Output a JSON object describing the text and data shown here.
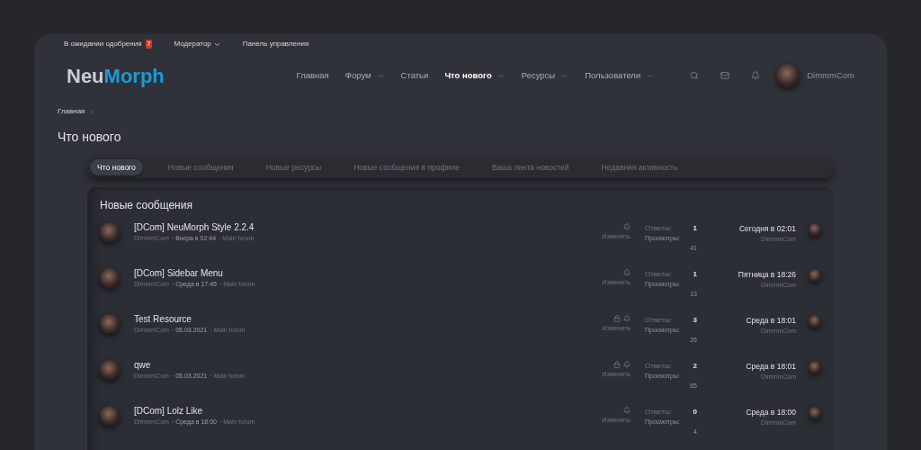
{
  "top_bar": [
    {
      "label": "В ожидании одобрения",
      "badge": "7",
      "dropdown": false
    },
    {
      "label": "Модератор",
      "dropdown": true
    },
    {
      "label": "Панель управления",
      "dropdown": false
    }
  ],
  "logo": {
    "part_1": "Neu",
    "part_2": "Morph"
  },
  "nav": [
    {
      "label": "Главная",
      "selected": false,
      "dropdown": false
    },
    {
      "label": "Форум",
      "selected": false,
      "dropdown": true
    },
    {
      "label": "Статьи",
      "selected": false,
      "dropdown": false
    },
    {
      "label": "Что нового",
      "selected": true,
      "dropdown": true
    },
    {
      "label": "Ресурсы",
      "selected": false,
      "dropdown": true
    },
    {
      "label": "Пользователи",
      "selected": false,
      "dropdown": true
    }
  ],
  "user": {
    "name": "DimmmCom"
  },
  "breadcrumb": [
    "Главная"
  ],
  "page_title": "Что нового",
  "tabs": [
    {
      "label": "Что нового",
      "selected": true
    },
    {
      "label": "Новые сообщения",
      "selected": false
    },
    {
      "label": "Новые ресурсы",
      "selected": false
    },
    {
      "label": "Новые сообщения в профиле",
      "selected": false
    },
    {
      "label": "Ваша лента новостей",
      "selected": false
    },
    {
      "label": "Недавняя активность",
      "selected": false
    }
  ],
  "block_title": "Новые сообщения",
  "threads": [
    {
      "title": "[DCom] NeuMorph Style 2.2.4",
      "author": "DimmmCom",
      "date": "· Вчера в 02:44",
      "forum": "· Main forum",
      "locked": false,
      "edit": "Изменить",
      "replies_label": "Ответы:",
      "replies": "1",
      "views_label": "Просмотры:",
      "views": "41",
      "last_date": "Сегодня в 02:01",
      "last_user": "DimmmCom"
    },
    {
      "title": "[DCom] Sidebar Menu",
      "author": "DimmmCom",
      "date": "· Среда в 17:45",
      "forum": "· Main forum",
      "locked": false,
      "edit": "Изменить",
      "replies_label": "Ответы:",
      "replies": "1",
      "views_label": "Просмотры:",
      "views": "13",
      "last_date": "Пятница в 18:26",
      "last_user": "DimmmCom"
    },
    {
      "title": "Test Resource",
      "author": "DimmmCom",
      "date": "· 05.03.2021",
      "forum": "· Main forum",
      "locked": true,
      "edit": "Изменить",
      "replies_label": "Ответы:",
      "replies": "3",
      "views_label": "Просмотры:",
      "views": "26",
      "last_date": "Среда в 18:01",
      "last_user": "DimmmCom"
    },
    {
      "title": "qwe",
      "author": "DimmmCom",
      "date": "· 05.03.2021",
      "forum": "· Main forum",
      "locked": true,
      "edit": "Изменить",
      "replies_label": "Ответы:",
      "replies": "2",
      "views_label": "Просмотры:",
      "views": "65",
      "last_date": "Среда в 18:01",
      "last_user": "DimmmCom"
    },
    {
      "title": "[DCom] Lolz Like",
      "author": "DimmmCom",
      "date": "· Среда в 18:00",
      "forum": "· Main forum",
      "locked": false,
      "edit": "Изменить",
      "replies_label": "Ответы:",
      "replies": "0",
      "views_label": "Просмотры:",
      "views": "4",
      "last_date": "Среда в 18:00",
      "last_user": "DimmmCom"
    }
  ]
}
